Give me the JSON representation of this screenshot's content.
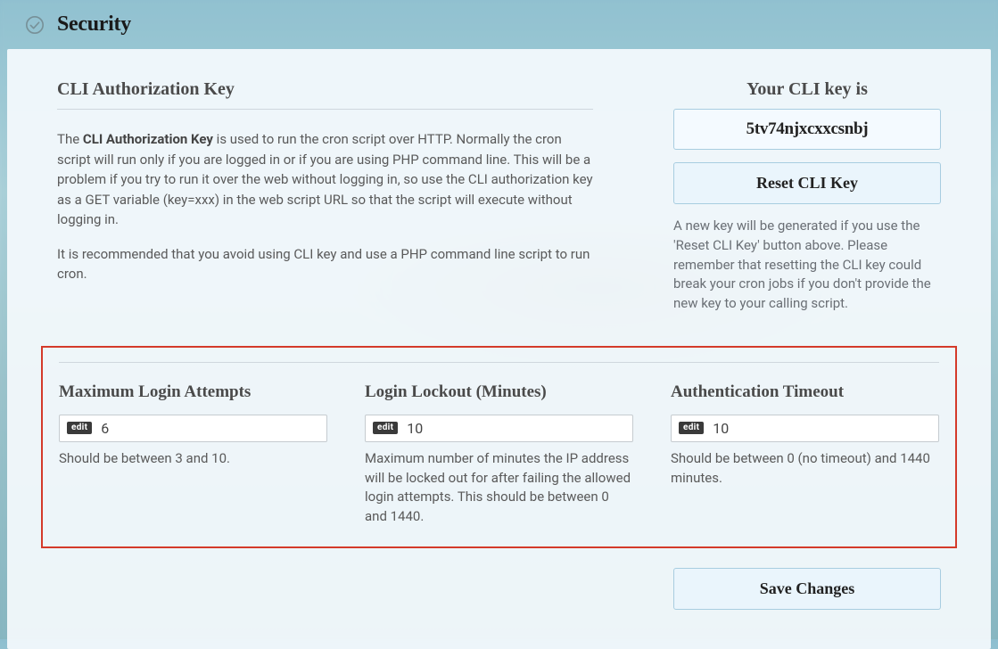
{
  "header": {
    "title": "Security"
  },
  "cli_section": {
    "heading": "CLI Authorization Key",
    "para1_prefix": "The ",
    "para1_strong": "CLI Authorization Key",
    "para1_rest": " is used to run the cron script over HTTP. Normally the cron script will run only if you are logged in or if you are using PHP command line. This will be a problem if you try to run it over the web without logging in, so use the CLI authorization key as a GET variable (key=xxx) in the web script URL so that the script will execute without logging in.",
    "para2": "It is recommended that you avoid using CLI key and use a PHP command line script to run cron."
  },
  "key_panel": {
    "heading": "Your CLI key is",
    "key_value": "5tv74njxcxxcsnbj",
    "reset_label": "Reset CLI Key",
    "note": "A new key will be generated if you use the 'Reset CLI Key' button above. Please remember that resetting the CLI key could break your cron jobs if you don't provide the new key to your calling script."
  },
  "settings": {
    "edit_badge_label": "edit",
    "max_login": {
      "heading": "Maximum Login Attempts",
      "value": "6",
      "hint": "Should be between 3 and 10."
    },
    "lockout": {
      "heading": "Login Lockout (Minutes)",
      "value": "10",
      "hint": "Maximum number of minutes the IP address will be locked out for after failing the allowed login attempts. This should be between 0 and 1440."
    },
    "auth_timeout": {
      "heading": "Authentication Timeout",
      "value": "10",
      "hint": "Should be between 0 (no timeout) and 1440 minutes."
    }
  },
  "actions": {
    "save_label": "Save Changes"
  }
}
